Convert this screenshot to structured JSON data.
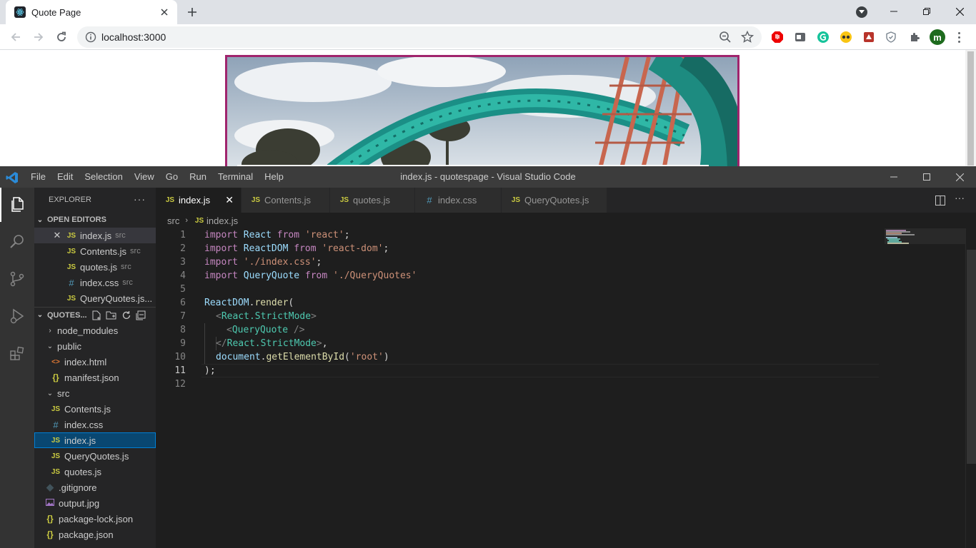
{
  "browser": {
    "tab": {
      "title": "Quote Page"
    },
    "url": "localhost:3000",
    "avatar_letter": "m"
  },
  "vscode": {
    "menu": [
      "File",
      "Edit",
      "Selection",
      "View",
      "Go",
      "Run",
      "Terminal",
      "Help"
    ],
    "window_title": "index.js - quotespage - Visual Studio Code",
    "explorer": {
      "title": "EXPLORER",
      "open_editors_label": "OPEN EDITORS",
      "open_editors": [
        {
          "name": "index.js",
          "desc": "src",
          "icon": "JS"
        },
        {
          "name": "Contents.js",
          "desc": "src",
          "icon": "JS"
        },
        {
          "name": "quotes.js",
          "desc": "src",
          "icon": "JS"
        },
        {
          "name": "index.css",
          "desc": "src",
          "icon": "#"
        },
        {
          "name": "QueryQuotes.js...",
          "desc": "",
          "icon": "JS"
        }
      ],
      "project_label": "QUOTES...",
      "tree": [
        {
          "name": "node_modules",
          "icon": "folder-collapsed"
        },
        {
          "name": "public",
          "icon": "folder-expanded"
        },
        {
          "name": "index.html",
          "icon": "<>"
        },
        {
          "name": "manifest.json",
          "icon": "{}"
        },
        {
          "name": "src",
          "icon": "folder-expanded"
        },
        {
          "name": "Contents.js",
          "icon": "JS"
        },
        {
          "name": "index.css",
          "icon": "#"
        },
        {
          "name": "index.js",
          "icon": "JS"
        },
        {
          "name": "QueryQuotes.js",
          "icon": "JS"
        },
        {
          "name": "quotes.js",
          "icon": "JS"
        },
        {
          "name": ".gitignore",
          "icon": "◆"
        },
        {
          "name": "output.jpg",
          "icon": "image"
        },
        {
          "name": "package-lock.json",
          "icon": "{}"
        },
        {
          "name": "package.json",
          "icon": "{}"
        }
      ]
    },
    "tabs": [
      {
        "label": "index.js",
        "icon": "JS"
      },
      {
        "label": "Contents.js",
        "icon": "JS"
      },
      {
        "label": "quotes.js",
        "icon": "JS"
      },
      {
        "label": "index.css",
        "icon": "#"
      },
      {
        "label": "QueryQuotes.js",
        "icon": "JS"
      }
    ],
    "breadcrumb": [
      "src",
      "index.js"
    ],
    "line_numbers": [
      "1",
      "2",
      "3",
      "4",
      "5",
      "6",
      "7",
      "8",
      "9",
      "10",
      "11",
      "12"
    ],
    "current_line": "11",
    "code": {
      "l1": [
        "import",
        " ",
        "React",
        " ",
        "from",
        " ",
        "'react'",
        ";"
      ],
      "l2": [
        "import",
        " ",
        "ReactDOM",
        " ",
        "from",
        " ",
        "'react-dom'",
        ";"
      ],
      "l3": [
        "import",
        " ",
        "'./index.css'",
        ";"
      ],
      "l4": [
        "import",
        " ",
        "QueryQuote",
        " ",
        "from",
        " ",
        "'./QueryQuotes'"
      ],
      "l6": [
        "ReactDOM",
        ".",
        "render",
        "("
      ],
      "l7": [
        "<",
        "React.StrictMode",
        ">"
      ],
      "l8": [
        "<",
        "QueryQuote",
        " />"
      ],
      "l9": [
        "</",
        "React.StrictMode",
        ">",
        ","
      ],
      "l10": [
        "document",
        ".",
        "getElementById",
        "(",
        "'root'",
        ")"
      ],
      "l11": [
        ");"
      ]
    }
  }
}
